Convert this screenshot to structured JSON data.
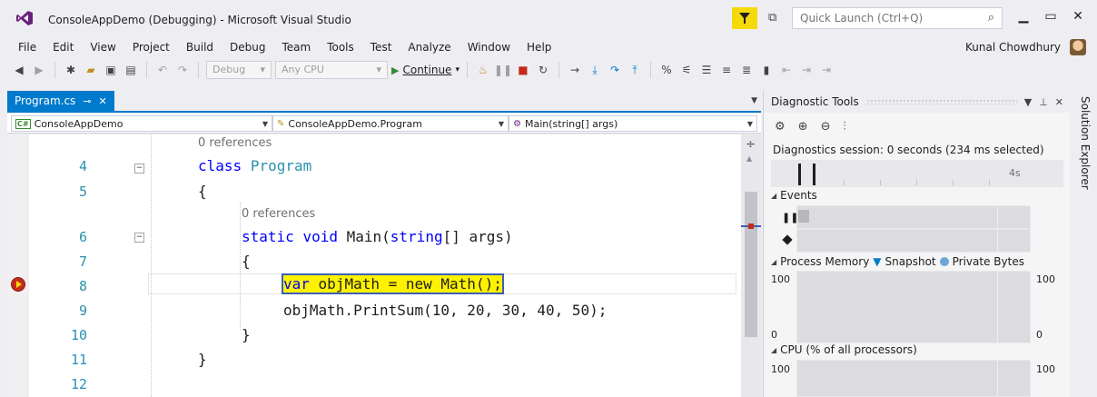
{
  "window": {
    "title": "ConsoleAppDemo (Debugging) - Microsoft Visual Studio",
    "quick_launch_placeholder": "Quick Launch (Ctrl+Q)",
    "user": "Kunal Chowdhury"
  },
  "menu": [
    "File",
    "Edit",
    "View",
    "Project",
    "Build",
    "Debug",
    "Team",
    "Tools",
    "Test",
    "Analyze",
    "Window",
    "Help"
  ],
  "toolbar": {
    "config": "Debug",
    "platform": "Any CPU",
    "continue_label": "Continue"
  },
  "editor": {
    "tab_label": "Program.cs",
    "nav_project": "ConsoleAppDemo",
    "nav_class": "ConsoleAppDemo.Program",
    "nav_member": "Main(string[] args)",
    "refs_label": "0 references",
    "lines": [
      {
        "num": "4",
        "code": "class Program"
      },
      {
        "num": "5",
        "code": "{"
      },
      {
        "num": "6",
        "code": "static void Main(string[] args)"
      },
      {
        "num": "7",
        "code": "{"
      },
      {
        "num": "8",
        "code": "var objMath = new Math();"
      },
      {
        "num": "9",
        "code": "objMath.PrintSum(10, 20, 30, 40, 50);"
      },
      {
        "num": "10",
        "code": "}"
      },
      {
        "num": "11",
        "code": "}"
      },
      {
        "num": "12",
        "code": ""
      }
    ],
    "tokens": {
      "kw_class": "class",
      "type_program": "Program",
      "kw_static": "static",
      "kw_void": "void",
      "main_sig": "Main(",
      "kw_string": "string",
      "args_sig": "[] args)",
      "kw_var": "var",
      "stmt8_rest": " objMath = new ",
      "math_call": "Math",
      "stmt8_end": "();"
    }
  },
  "diagnostics": {
    "title": "Diagnostic Tools",
    "session": "Diagnostics session: 0 seconds (234 ms selected)",
    "timeline_label": "4s",
    "events_label": "Events",
    "memory_label": "Process Memory",
    "snapshot_label": "Snapshot",
    "private_bytes_label": "Private Bytes",
    "memory_max": "100",
    "memory_min": "0",
    "cpu_label": "CPU (% of all processors)",
    "cpu_max": "100"
  },
  "side_panel": {
    "label": "Solution Explorer"
  }
}
